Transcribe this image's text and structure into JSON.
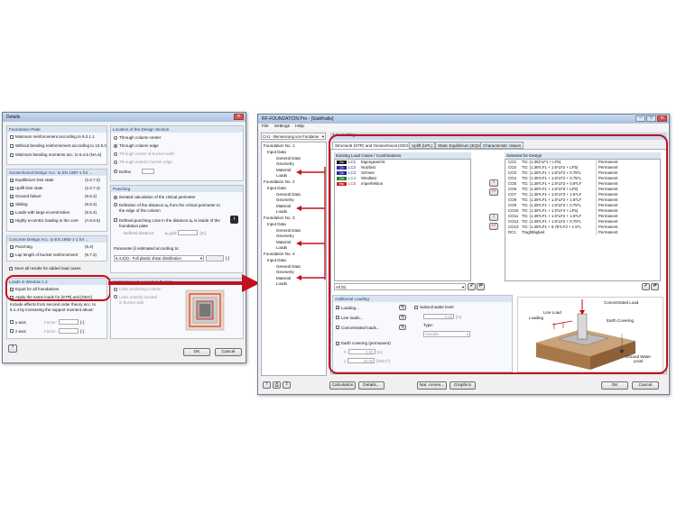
{
  "details": {
    "title": "Details",
    "foundation_plate": {
      "header": "Foundation Plate",
      "items": [
        {
          "label": "Minimum reinforcement according to 9.2.1.1",
          "checked": false
        },
        {
          "label": "Without bending reinforcement according to 12.9.3",
          "checked": false
        },
        {
          "label": "Minimum bending moments acc. to 6.4.5 (NA.6)",
          "checked": false
        }
      ]
    },
    "location": {
      "header": "Location of the Design Section",
      "items": [
        {
          "label": "Through column center",
          "checked": false
        },
        {
          "label": "Through column edge",
          "checked": true
        },
        {
          "label": "Through center of bucket walls",
          "checked": false
        },
        {
          "label": "Through exterior bucket edge",
          "checked": false
        },
        {
          "label": "Define",
          "checked": false
        }
      ]
    },
    "geotechnical": {
      "header": "Geotechnical Design Acc. to EN 1997-1 for ...",
      "items": [
        {
          "label": "Equilibrium limit state",
          "ref": "(2.4.7.2)",
          "checked": true
        },
        {
          "label": "Uplift limit state",
          "ref": "(2.4.7.4)",
          "checked": true
        },
        {
          "label": "Ground failure",
          "ref": "(6.5.2)",
          "checked": true
        },
        {
          "label": "Sliding",
          "ref": "(6.5.3)",
          "checked": true
        },
        {
          "label": "Loads with large eccentricities",
          "ref": "(6.5.4)",
          "checked": true
        },
        {
          "label": "Highly eccentric loading in the core",
          "ref": "(A 6.6.5)",
          "checked": true
        }
      ]
    },
    "punching": {
      "header": "Punching",
      "items": [
        {
          "label": "Iterated calculation of the critical perimeter",
          "checked": true
        },
        {
          "label": "Definition of the distance aₑ from the critical perimeter to the edge of the column",
          "checked": false
        }
      ],
      "cone_check": "Defined punching cone in the distance aₑ is inside of the foundation plate",
      "distance_label": "Defined distance",
      "distance_sym": "aₑ,grid",
      "unit": "[m]"
    },
    "concrete": {
      "header": "Concrete Design Acc. to EN 1992-1-1 for ...",
      "items": [
        {
          "label": "Punching",
          "ref": "(6.4)",
          "checked": true
        },
        {
          "label": "Lap length of bucket reinforcement",
          "ref": "(8.7.3)",
          "checked": true
        }
      ]
    },
    "beta": {
      "label": "Parameter β estimated according to:",
      "value": "6.4.3(3) - Full plastic shear distribution",
      "unit": "[-]"
    },
    "save_all": "Save all results for added load cases",
    "loads_window": {
      "header": "Loads in Window 1.4",
      "equal": "Equal for all foundations",
      "apply": "Apply the same loads for [STR] and [GEO]",
      "note": "Include effects from second order theory acc. to 5.1.4 by increasing the support moment about:",
      "y_axis": "y-axis",
      "z_axis": "z-axis",
      "factor": "Factor:",
      "unit": "[-]"
    },
    "horizontal": {
      "header": "Horizontal Link Layout in Bucket",
      "opt1": "Links enclosing column",
      "opt2": "Links entirely located in bucket wall"
    },
    "ok": "OK",
    "cancel": "Cancel"
  },
  "rf": {
    "title": "RF-FOUNDATION Pro - [Stahlhalle]",
    "menu": [
      "File",
      "Settings",
      "Help"
    ],
    "case_select": "CA1 - Bemessung von Fundame",
    "panel_title": "1.4 Loading",
    "tree": [
      {
        "name": "Foundation No. 1",
        "children": [
          "Input Data",
          "General Data",
          "Geometry",
          "Material",
          "Loads"
        ]
      },
      {
        "name": "Foundation No. 2",
        "children": [
          "Input Data",
          "General Data",
          "Geometry",
          "Material",
          "Loads"
        ]
      },
      {
        "name": "Foundation No. 3",
        "children": [
          "Input Data",
          "General Data",
          "Geometry",
          "Material",
          "Loads"
        ]
      },
      {
        "name": "Foundation No. 4",
        "children": [
          "Input Data",
          "General Data",
          "Geometry",
          "Material",
          "Loads"
        ]
      }
    ],
    "tabs": [
      "Structural (STR) and Geotechnical (GEO)",
      "Uplift (UPL)",
      "Static Equilibrium (EQU)",
      "Characteristic Values"
    ],
    "existing_header": "Existing Load Cases / Combinations",
    "existing": [
      {
        "tag": "Sw",
        "id": "LC1",
        "name": "Eigengewicht",
        "color": "#1a1a1a"
      },
      {
        "tag": "Qs",
        "id": "LC2",
        "name": "Nutzlast",
        "color": "#2a2a9a"
      },
      {
        "tag": "Qs",
        "id": "LC3",
        "name": "Schnee",
        "color": "#2a2a9a"
      },
      {
        "tag": "Qw",
        "id": "LC4",
        "name": "Windlast",
        "color": "#2e7d32"
      },
      {
        "tag": "Imp",
        "id": "LC5",
        "name": "Imperfektion",
        "color": "#c62828"
      }
    ],
    "all_filter": "All (5)",
    "selected_header": "Selected for Design",
    "selected": [
      {
        "id": "CO1",
        "formula": "TG: (1.35)*LF1 + LF5)",
        "type": "Permanent"
      },
      {
        "id": "CO2",
        "formula": "TG: (1.35*LF1 + 1.5*LF2 + LF5)",
        "type": "Permanent"
      },
      {
        "id": "CO3",
        "formula": "TG: (1.35*LF1 + 1.5*LF2 + 0.75*L",
        "type": "Permanent"
      },
      {
        "id": "CO4",
        "formula": "TG: (1.35*LF1 + 1.5*LF2 + 0.75*L",
        "type": "Permanent"
      },
      {
        "id": "CO5",
        "formula": "TG: (1.35*LF1 + 1.5*LF2 + 0.9*LF",
        "type": "Permanent"
      },
      {
        "id": "CO6",
        "formula": "TG: (1.35*LF1 + 1.5*LF3 + LF5)",
        "type": "Permanent"
      },
      {
        "id": "CO7",
        "formula": "TG: (1.35*LF1 + 1.5*LF3 + 1.5*LF",
        "type": "Permanent"
      },
      {
        "id": "CO8",
        "formula": "TG: (1.35*LF1 + 1.5*LF2 + 1.5*LF",
        "type": "Permanent"
      },
      {
        "id": "CO9",
        "formula": "TG: (1.35*LF1 + 1.5*LF3 + 0.75*L",
        "type": "Permanent"
      },
      {
        "id": "CO10",
        "formula": "TG: (1.35*LF1 + 1.5*LF4 + LF5)",
        "type": "Permanent"
      },
      {
        "id": "CO11",
        "formula": "TG: (1.35*LF1 + 1.5*LF2 + 1.5*LF",
        "type": "Permanent"
      },
      {
        "id": "CO12",
        "formula": "TG: (1.35*LF1 + 1.5*LF2 + 0.75*L",
        "type": "Permanent"
      },
      {
        "id": "CO13",
        "formula": "TG: (1.35*LF1 + 0.75*LF3 + 1.5*L",
        "type": "Permanent"
      },
      {
        "id": "RC1",
        "formula": "Tragfähigkeit",
        "type": "Permanent"
      }
    ],
    "additional": {
      "header": "Additional Loading",
      "loading": "Loading...",
      "line_loads": "Line loads...",
      "conc_loads": "Concentrated loads...",
      "subsoil": "Subsoil water level",
      "subsoil_val": "0.00",
      "subsoil_unit": "[m]",
      "type_label": "Type:",
      "type_value": "Variable",
      "earth": "Earth covering (permanent)",
      "h_val": "0.00",
      "h_unit": "[m]",
      "g_val": "20.00",
      "g_unit": "[kN/m³]"
    },
    "figure": {
      "line_load": "Line Load",
      "loading": "Loading",
      "concentrated": "Concentrated Load",
      "earth": "Earth Covering",
      "ground_water": "Ground Water Level"
    },
    "buttons": {
      "calculation": "Calculation",
      "details": "Details...",
      "nat_annex": "Nat. Annex...",
      "graphics": "Graphics",
      "ok": "OK",
      "cancel": "Cancel"
    }
  }
}
